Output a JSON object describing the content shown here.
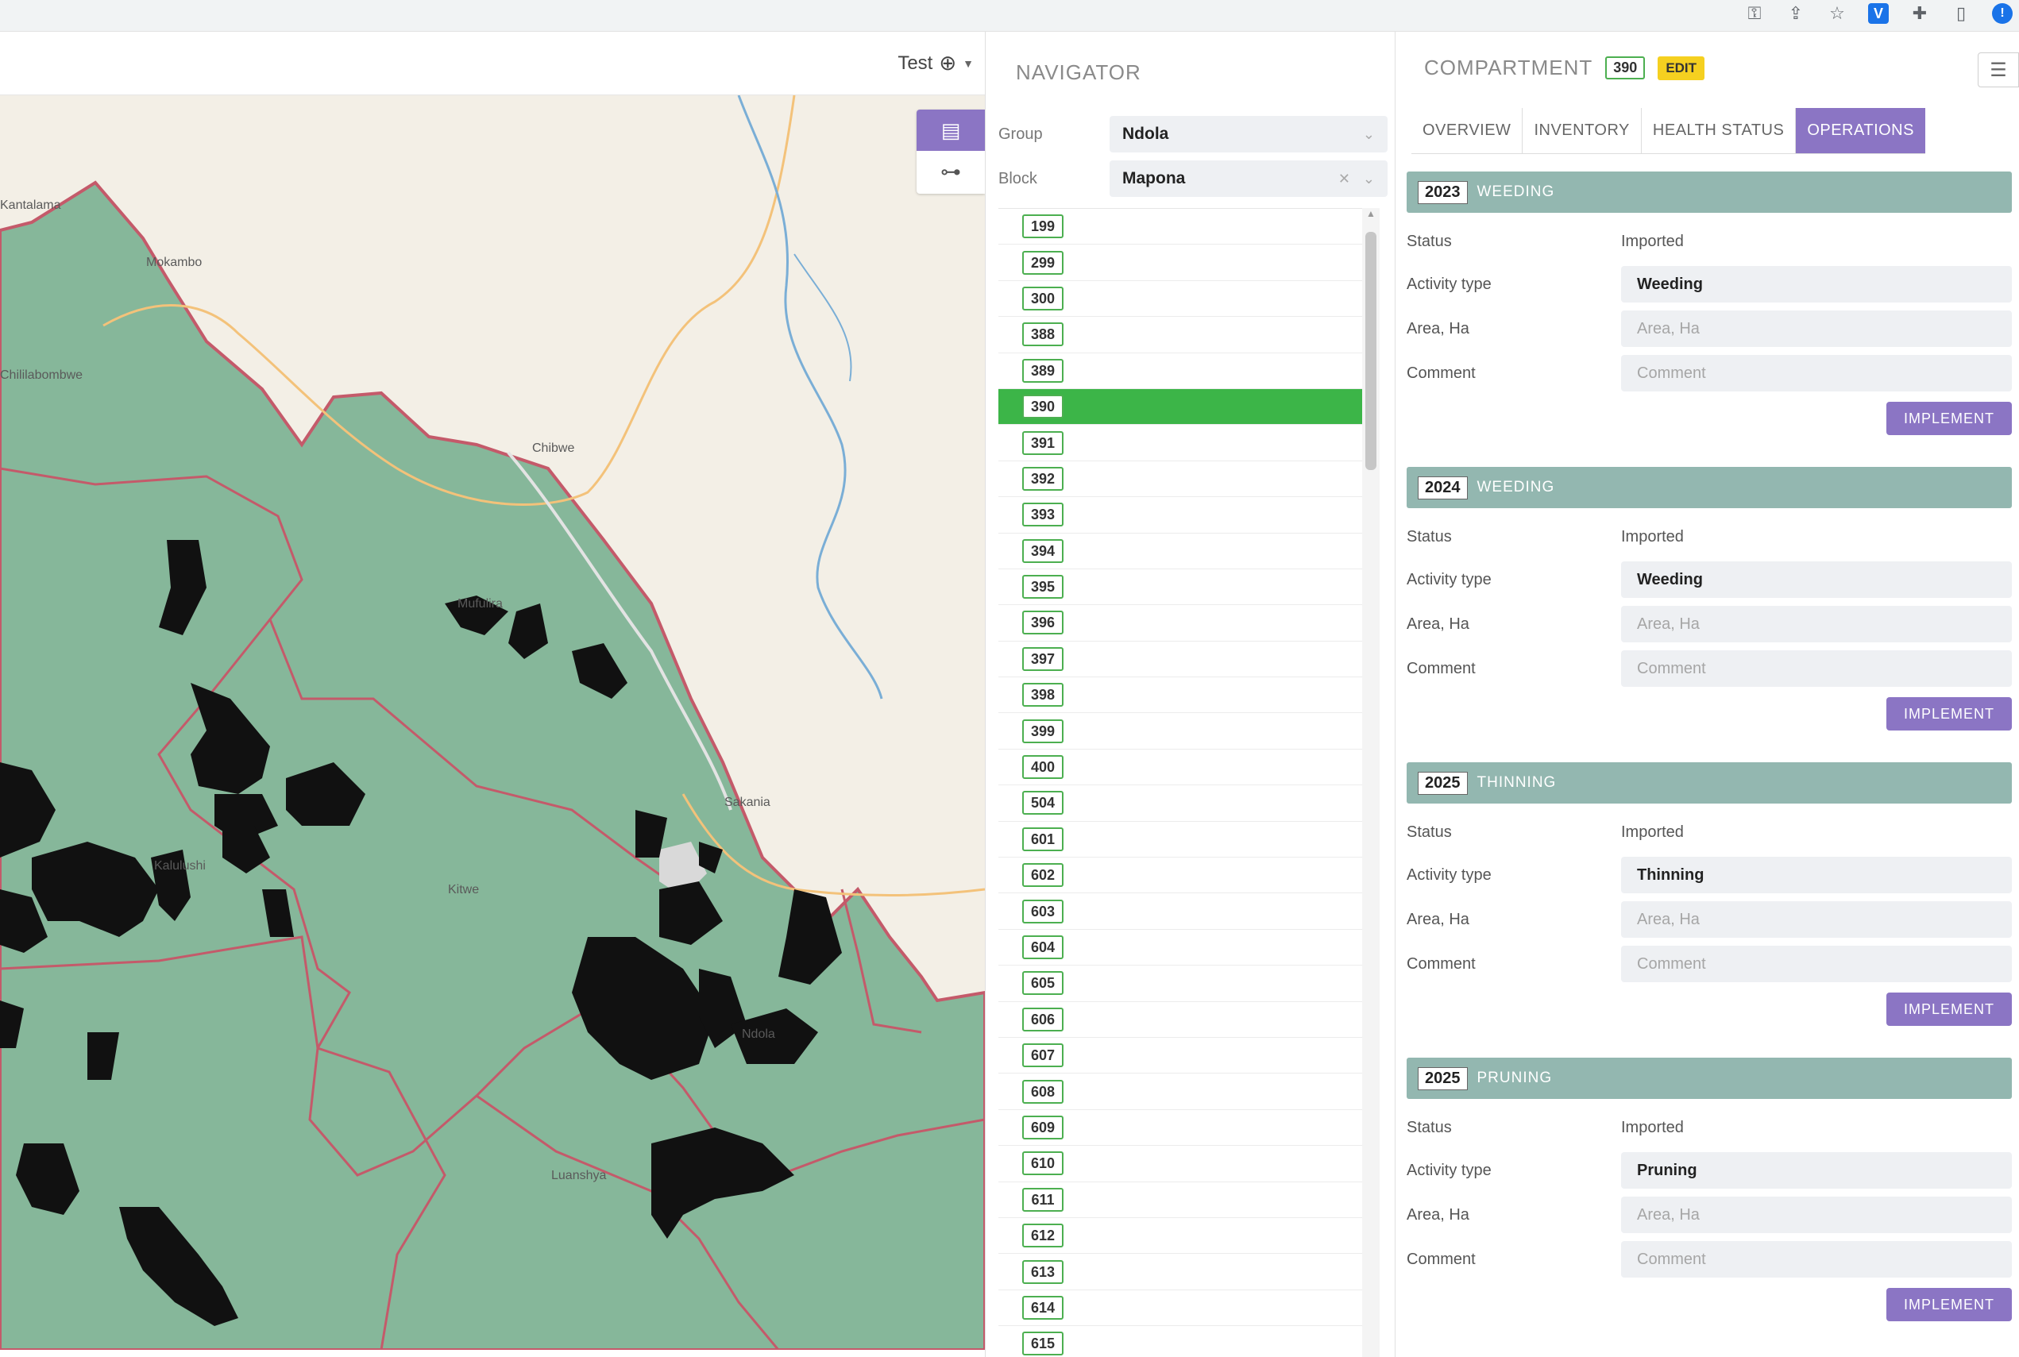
{
  "browser": {
    "icons": [
      "key-icon",
      "share-icon",
      "star-icon",
      "extension-v-icon",
      "puzzle-icon",
      "side-panel-icon",
      "profile-icon"
    ],
    "ext_label": "V",
    "profile_label": "!"
  },
  "map": {
    "user_name": "Test",
    "labels": {
      "l1": "Kantalama",
      "l2": "Kitwe",
      "l3": "Chibwe",
      "l4": "Sakania",
      "l5": "Ndola",
      "l6": "Luanshya",
      "l7": "Mufulira",
      "l8": "Kalulushi",
      "l9": "Chililabombwe",
      "l10": "Mokambo"
    },
    "colors": {
      "land": "#86b79a",
      "border": "#c45a6a",
      "water": "#7aaed6",
      "road": "#f3c27a",
      "plantation": "#111111"
    }
  },
  "navigator": {
    "title": "NAVIGATOR",
    "group_label": "Group",
    "group_value": "Ndola",
    "block_label": "Block",
    "block_value": "Mapona",
    "selected": "390",
    "compartments": [
      "199",
      "299",
      "300",
      "388",
      "389",
      "390",
      "391",
      "392",
      "393",
      "394",
      "395",
      "396",
      "397",
      "398",
      "399",
      "400",
      "504",
      "601",
      "602",
      "603",
      "604",
      "605",
      "606",
      "607",
      "608",
      "609",
      "610",
      "611",
      "612",
      "613",
      "614",
      "615"
    ]
  },
  "compartment": {
    "title": "COMPARTMENT",
    "id": "390",
    "edit_label": "EDIT",
    "tabs": [
      "OVERVIEW",
      "INVENTORY",
      "HEALTH STATUS",
      "OPERATIONS"
    ],
    "active_tab": "OPERATIONS",
    "field_labels": {
      "status": "Status",
      "activity": "Activity type",
      "area": "Area, Ha",
      "comment": "Comment"
    },
    "placeholders": {
      "area": "Area, Ha",
      "comment": "Comment"
    },
    "implement_label": "IMPLEMENT",
    "operations": [
      {
        "year": "2023",
        "name": "WEEDING",
        "status": "Imported",
        "activity": "Weeding"
      },
      {
        "year": "2024",
        "name": "WEEDING",
        "status": "Imported",
        "activity": "Weeding"
      },
      {
        "year": "2025",
        "name": "THINNING",
        "status": "Imported",
        "activity": "Thinning"
      },
      {
        "year": "2025",
        "name": "PRUNING",
        "status": "Imported",
        "activity": "Pruning"
      }
    ]
  }
}
